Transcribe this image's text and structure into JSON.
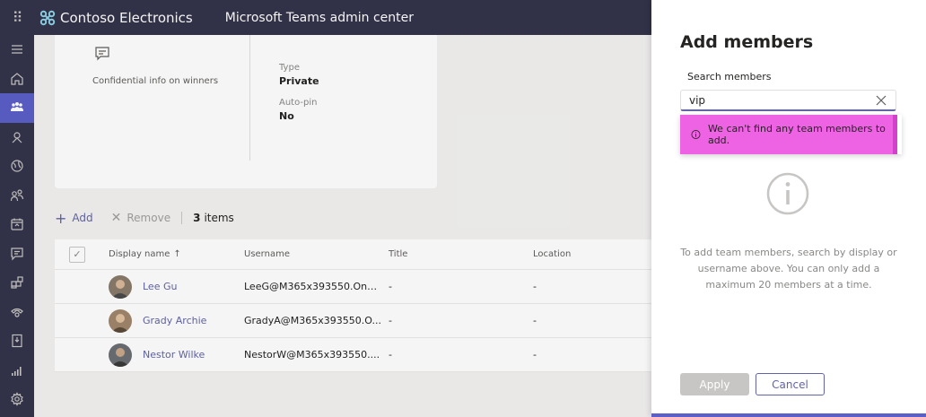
{
  "topbar": {
    "brand_name": "Contoso Electronics",
    "app_title": "Microsoft Teams admin center"
  },
  "rail": {
    "items": [
      {
        "icon": "hamburger-menu-icon"
      },
      {
        "icon": "home-icon"
      },
      {
        "icon": "teams-icon",
        "active": true
      },
      {
        "icon": "deployment-icon"
      },
      {
        "icon": "globe-icon"
      },
      {
        "icon": "users-icon"
      },
      {
        "icon": "meetings-icon"
      },
      {
        "icon": "messaging-icon"
      },
      {
        "icon": "apps-icon"
      },
      {
        "icon": "voice-icon"
      },
      {
        "icon": "locations-icon"
      },
      {
        "icon": "analytics-icon"
      },
      {
        "icon": "settings-icon"
      }
    ]
  },
  "card": {
    "description": "Confidential info on winners",
    "type_label": "Type",
    "type_value": "Private",
    "autopin_label": "Auto-pin",
    "autopin_value": "No"
  },
  "toolbar": {
    "add_label": "Add",
    "remove_label": "Remove",
    "count_number": "3",
    "count_label": "items"
  },
  "table": {
    "headers": {
      "display_name": "Display name",
      "username": "Username",
      "title": "Title",
      "location": "Location"
    },
    "rows": [
      {
        "name": "Lee Gu",
        "username": "LeeG@M365x393550.OnM...",
        "title": "-",
        "location": "-",
        "avatar_color": "#8a7b6b"
      },
      {
        "name": "Grady Archie",
        "username": "GradyA@M365x393550.O...",
        "title": "-",
        "location": "-",
        "avatar_color": "#a0866b"
      },
      {
        "name": "Nestor Wilke",
        "username": "NestorW@M365x393550....",
        "title": "-",
        "location": "-",
        "avatar_color": "#6b6e73"
      }
    ]
  },
  "panel": {
    "title": "Add members",
    "search_label": "Search members",
    "search_value": "vip",
    "error_message": "We can't find any team members to add.",
    "help_text": "To add team members, search by display or username above. You can only add a maximum 20 members at a time.",
    "apply_label": "Apply",
    "cancel_label": "Cancel"
  },
  "colors": {
    "accent": "#6264a7",
    "rail_bg": "#33344a",
    "error_bg": "#ee63e3"
  }
}
